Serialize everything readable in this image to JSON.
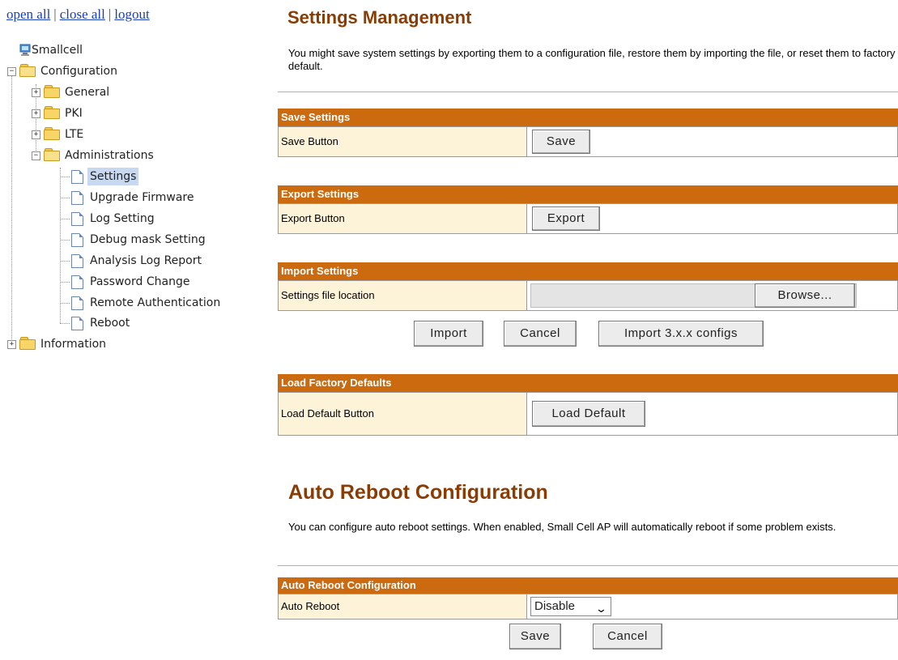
{
  "top_links": {
    "open_all": "open all",
    "close_all": "close all",
    "logout": "logout",
    "separator": "|"
  },
  "tree": {
    "root": "Smallcell",
    "configuration": "Configuration",
    "general": "General",
    "pki": "PKI",
    "lte": "LTE",
    "administrations": "Administrations",
    "settings": "Settings",
    "upgrade_firmware": "Upgrade Firmware",
    "log_setting": "Log Setting",
    "debug_mask": "Debug mask Setting",
    "analysis_log": "Analysis Log Report",
    "password_change": "Password Change",
    "remote_auth": "Remote Authentication",
    "reboot": "Reboot",
    "information": "Information",
    "expand_glyph": "+",
    "collapse_glyph": "−"
  },
  "settings_mgmt": {
    "title": "Settings Management",
    "description": "You might save system settings by exporting them to a configuration file, restore them by importing the file, or reset them to factory default.",
    "save": {
      "header": "Save Settings",
      "label": "Save Button",
      "button": "Save"
    },
    "export": {
      "header": "Export Settings",
      "label": "Export Button",
      "button": "Export"
    },
    "import": {
      "header": "Import Settings",
      "label": "Settings file location",
      "browse": "Browse...",
      "import_button": "Import",
      "cancel_button": "Cancel",
      "import3_button": "Import 3.x.x configs"
    },
    "factory": {
      "header": "Load Factory Defaults",
      "label": "Load Default Button",
      "button": "Load Default"
    }
  },
  "auto_reboot": {
    "title": "Auto Reboot Configuration",
    "description": "You can configure auto reboot settings. When enabled, Small Cell AP will automatically reboot if some problem exists.",
    "header": "Auto Reboot Configuration",
    "label": "Auto Reboot",
    "selected": "Disable",
    "save_button": "Save",
    "cancel_button": "Cancel"
  },
  "colors": {
    "title": "#8a3c05",
    "header_bar": "#cc6a10",
    "label_cell": "#fcf3d8",
    "link": "#1a3fb5",
    "selected_node": "#c8d8f0"
  }
}
